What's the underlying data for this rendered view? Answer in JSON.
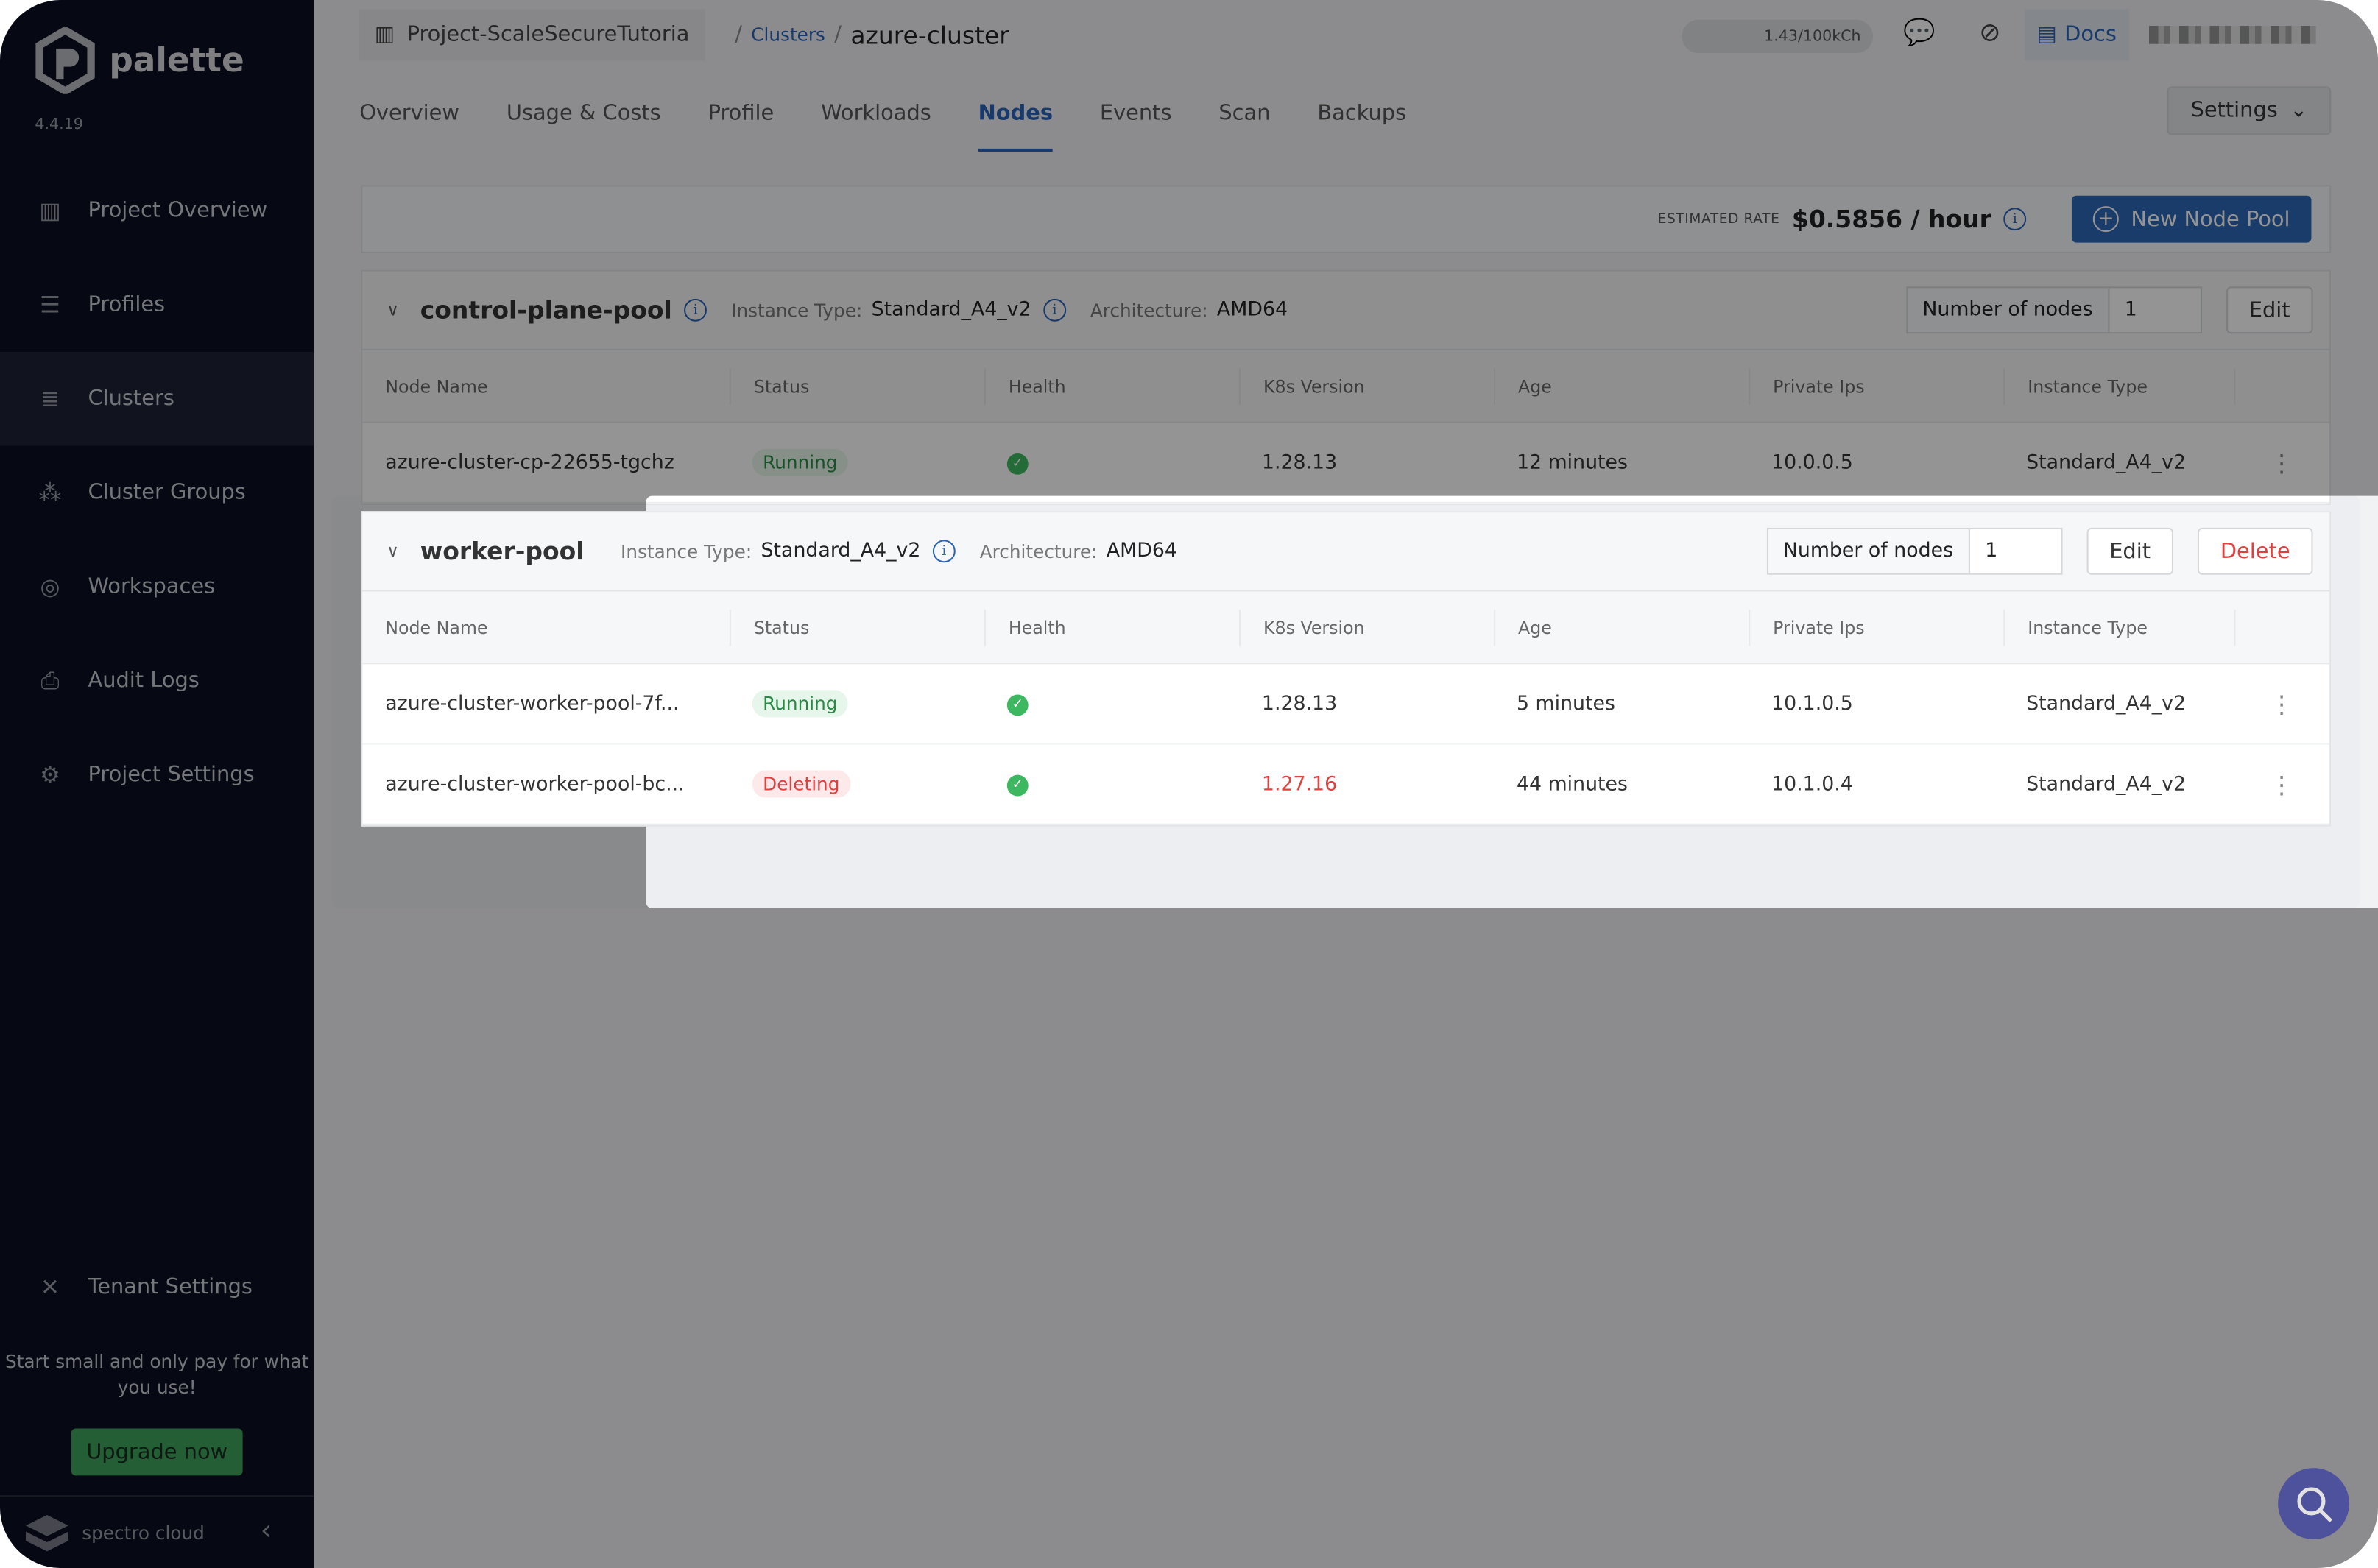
{
  "app": {
    "name": "palette",
    "version": "4.4.19",
    "footer_brand": "spectro cloud"
  },
  "sidebar": {
    "items": [
      {
        "label": "Project Overview",
        "icon": "chart-icon"
      },
      {
        "label": "Profiles",
        "icon": "layers-icon"
      },
      {
        "label": "Clusters",
        "icon": "clusters-icon",
        "active": true
      },
      {
        "label": "Cluster Groups",
        "icon": "cluster-groups-icon"
      },
      {
        "label": "Workspaces",
        "icon": "workspaces-icon"
      },
      {
        "label": "Audit Logs",
        "icon": "audit-icon"
      },
      {
        "label": "Project Settings",
        "icon": "gear-icon"
      }
    ],
    "tenant_settings": "Tenant Settings",
    "promo": "Start small and only pay for what you use!",
    "upgrade": "Upgrade now"
  },
  "header": {
    "project": "Project-ScaleSecureTutoria",
    "breadcrumb_link": "Clusters",
    "current": "azure-cluster",
    "credits": "1.43/100kCh",
    "docs": "Docs"
  },
  "tabs": [
    {
      "label": "Overview"
    },
    {
      "label": "Usage & Costs"
    },
    {
      "label": "Profile"
    },
    {
      "label": "Workloads"
    },
    {
      "label": "Nodes",
      "active": true
    },
    {
      "label": "Events"
    },
    {
      "label": "Scan"
    },
    {
      "label": "Backups"
    }
  ],
  "settings_label": "Settings",
  "rate": {
    "label": "ESTIMATED RATE",
    "value": "$0.5856 / hour"
  },
  "new_pool": "New Node Pool",
  "columns": [
    "Node Name",
    "Status",
    "Health",
    "K8s Version",
    "Age",
    "Private Ips",
    "Instance Type"
  ],
  "labels": {
    "instance_type": "Instance Type:",
    "architecture": "Architecture:",
    "number_of_nodes": "Number of nodes",
    "edit": "Edit",
    "delete": "Delete"
  },
  "pools": [
    {
      "name": "control-plane-pool",
      "instance_type": "Standard_A4_v2",
      "architecture": "AMD64",
      "nodes": "1",
      "rows": [
        {
          "name": "azure-cluster-cp-22655-tgchz",
          "status": "Running",
          "k8s": "1.28.13",
          "age": "12 minutes",
          "ip": "10.0.0.5",
          "type": "Standard_A4_v2"
        }
      ]
    },
    {
      "name": "worker-pool",
      "instance_type": "Standard_A4_v2",
      "architecture": "AMD64",
      "nodes": "1",
      "rows": [
        {
          "name": "azure-cluster-worker-pool-7f...",
          "status": "Running",
          "k8s": "1.28.13",
          "age": "5 minutes",
          "ip": "10.1.0.5",
          "type": "Standard_A4_v2"
        },
        {
          "name": "azure-cluster-worker-pool-bc...",
          "status": "Deleting",
          "k8s": "1.27.16",
          "age": "44 minutes",
          "ip": "10.1.0.4",
          "type": "Standard_A4_v2"
        }
      ]
    }
  ],
  "colors": {
    "accent": "#2e68b8",
    "running": "#2a8a45",
    "deleting": "#e0413f",
    "sidebar": "#0c0f22",
    "upgrade": "#3da35a"
  }
}
